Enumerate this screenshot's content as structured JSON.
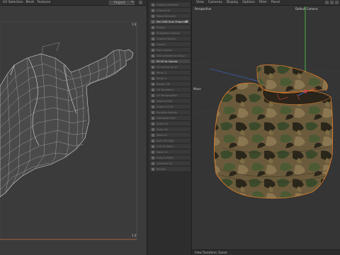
{
  "uv_editor": {
    "menu": [
      "UV Selection",
      "Mesh",
      "Textures"
    ],
    "layer_dropdown": "Project",
    "axis_labels": {
      "top_right": "1.0",
      "bottom_right": "1.0"
    }
  },
  "tools": [
    {
      "label": "Unwrap Selected",
      "active": false
    },
    {
      "label": "Unwrap All",
      "active": false
    },
    {
      "label": "Relax Selected",
      "active": false
    },
    {
      "label": "Set UVW from Projection",
      "active": true,
      "gear": true
    },
    {
      "label": "Project",
      "active": false
    },
    {
      "label": "Straighten Islands",
      "active": false
    },
    {
      "label": "Unwrap Seams",
      "active": false
    },
    {
      "label": "Layout",
      "active": false
    },
    {
      "label": "Pack Islands",
      "active": false
    },
    {
      "label": "Add Selected to Group",
      "active": false
    },
    {
      "label": "Fit UV to Canvas",
      "active": true
    },
    {
      "label": "Fit Canvas to UV",
      "active": false
    },
    {
      "label": "Mirror U",
      "active": false
    },
    {
      "label": "Mirror V",
      "active": false
    },
    {
      "label": "Rotate CW",
      "active": false
    },
    {
      "label": "UV Transform",
      "active": false
    },
    {
      "label": "UV Manipulation",
      "active": false
    },
    {
      "label": "Align to Grid",
      "active": false
    },
    {
      "label": "Stretch to Fit",
      "active": false
    },
    {
      "label": "Equalize Islands",
      "active": false
    },
    {
      "label": "Distribute Grid",
      "active": false
    },
    {
      "label": "Scale UV",
      "active": false
    },
    {
      "label": "Scale UV",
      "active": false
    },
    {
      "label": "Weld UV",
      "active": false
    },
    {
      "label": "Split UV Edge",
      "active": false
    },
    {
      "label": "Cut UV Seam",
      "active": false
    },
    {
      "label": "Move UV",
      "active": false
    },
    {
      "label": "Snap to Pixel",
      "active": false
    },
    {
      "label": "Quantize UV",
      "active": false
    },
    {
      "label": "Remap",
      "active": false
    }
  ],
  "viewport": {
    "menu": [
      "View",
      "Cameras",
      "Display",
      "Options",
      "Filter",
      "Panel"
    ],
    "view_name": "Perspective",
    "camera_name": "Default Camera",
    "side_label": "Move",
    "status": "View Transform: Scene"
  },
  "colors": {
    "accent_orange": "#e8812a",
    "selection_red": "#d2453a",
    "axis_green": "#4fd14f",
    "axis_blue": "#3a6fe0"
  }
}
